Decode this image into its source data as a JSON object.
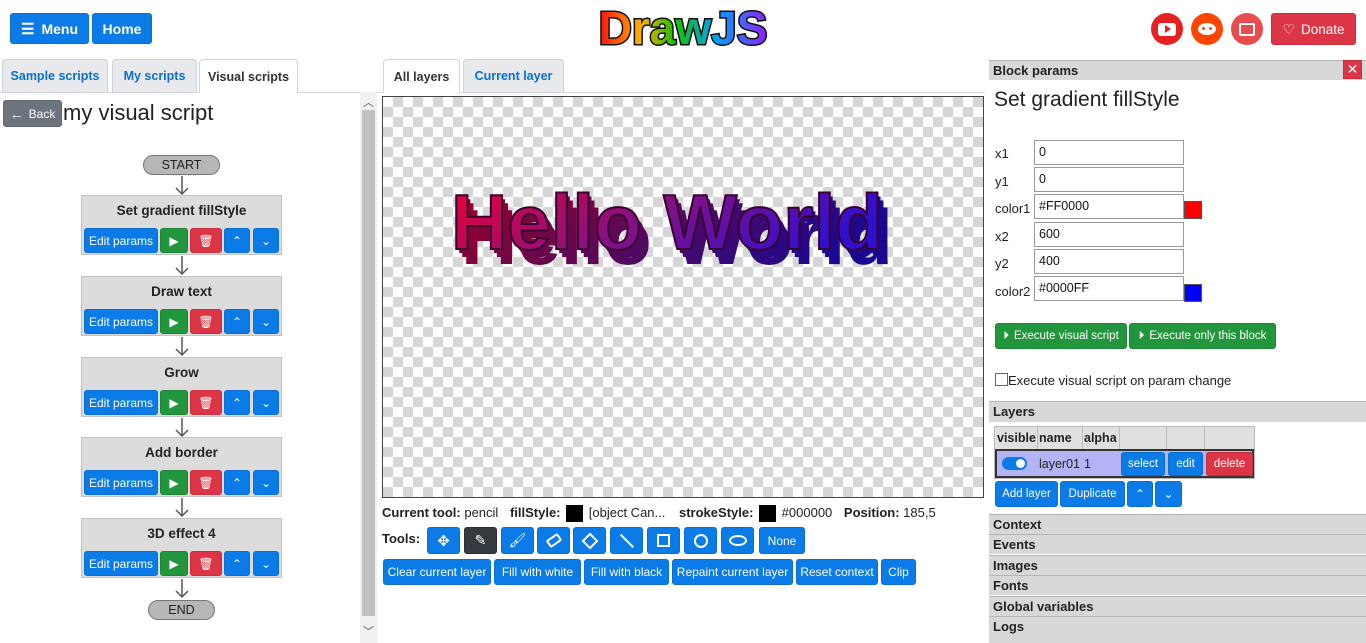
{
  "header": {
    "menu_label": "Menu",
    "home_label": "Home",
    "logo_text": "DrawJS",
    "donate_label": "Donate"
  },
  "left": {
    "tabs": [
      "Sample scripts",
      "My scripts",
      "Visual scripts"
    ],
    "back_label": "Back",
    "script_title": "my visual script",
    "start_label": "START",
    "end_label": "END",
    "blocks": [
      "Set gradient fillStyle",
      "Draw text",
      "Grow",
      "Add border",
      "3D effect 4"
    ],
    "edit_label": "Edit params"
  },
  "center": {
    "tabs": [
      "All layers",
      "Current layer"
    ],
    "canvas_text": "Hello World",
    "status": {
      "tool_label": "Current tool:",
      "tool_value": "pencil",
      "fill_label": "fillStyle:",
      "fill_value": "[object Can...",
      "stroke_label": "strokeStyle:",
      "stroke_value": "#000000",
      "position_label": "Position:",
      "position_value": "185,5"
    },
    "tools_label": "Tools:",
    "none_label": "None",
    "actions": [
      "Clear current layer",
      "Fill with white",
      "Fill with black",
      "Repaint current layer",
      "Reset context",
      "Clip"
    ]
  },
  "right": {
    "block_params_header": "Block params",
    "block_title": "Set gradient fillStyle",
    "params": [
      {
        "label": "x1",
        "value": "0"
      },
      {
        "label": "y1",
        "value": "0"
      },
      {
        "label": "color1",
        "value": "#FF0000",
        "swatch": "#FF0000"
      },
      {
        "label": "x2",
        "value": "600"
      },
      {
        "label": "y2",
        "value": "400"
      },
      {
        "label": "color2",
        "value": "#0000FF",
        "swatch": "#0000FF"
      }
    ],
    "execute_script_label": "Execute visual script",
    "execute_block_label": "Execute only this block",
    "auto_exec_label": "Execute visual script on param change",
    "layers_header": "Layers",
    "layer_cols": [
      "visible",
      "name",
      "alpha"
    ],
    "layer_row": {
      "name": "layer01",
      "alpha": "1"
    },
    "select_label": "select",
    "edit_label": "edit",
    "delete_label": "delete",
    "add_layer_label": "Add layer",
    "duplicate_label": "Duplicate",
    "sections": [
      "Context",
      "Events",
      "Images",
      "Fonts",
      "Global variables",
      "Logs"
    ]
  },
  "colors": {
    "primary": "#0b7be8",
    "success": "#22963c",
    "danger": "#dc3545",
    "dark": "#343a40",
    "gradient_start": "#FF0000",
    "gradient_end": "#0000FF"
  }
}
